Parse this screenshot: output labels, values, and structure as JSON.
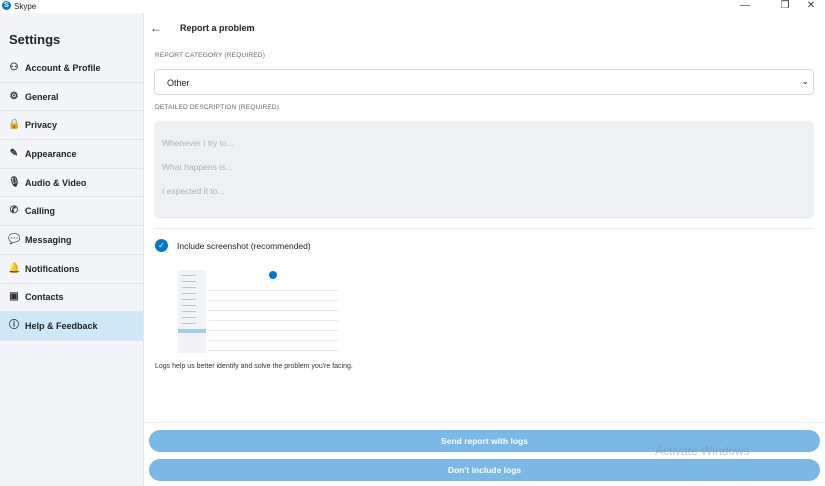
{
  "window": {
    "app_name": "Skype",
    "minimize": "—",
    "restore": "❐",
    "close": "✕"
  },
  "sidebar": {
    "title": "Settings",
    "items": [
      {
        "label": "Account & Profile",
        "icon": "person-icon",
        "glyph": "⚇"
      },
      {
        "label": "General",
        "icon": "gear-icon",
        "glyph": "⚙"
      },
      {
        "label": "Privacy",
        "icon": "lock-icon",
        "glyph": "🔒"
      },
      {
        "label": "Appearance",
        "icon": "wand-icon",
        "glyph": "✎"
      },
      {
        "label": "Audio & Video",
        "icon": "microphone-icon",
        "glyph": "🎙"
      },
      {
        "label": "Calling",
        "icon": "phone-icon",
        "glyph": "✆"
      },
      {
        "label": "Messaging",
        "icon": "chat-icon",
        "glyph": "💬"
      },
      {
        "label": "Notifications",
        "icon": "bell-icon",
        "glyph": "🔔"
      },
      {
        "label": "Contacts",
        "icon": "contacts-icon",
        "glyph": "▣"
      },
      {
        "label": "Help & Feedback",
        "icon": "info-icon",
        "glyph": "ⓘ",
        "active": true
      }
    ]
  },
  "main": {
    "back": "←",
    "title": "Report a problem",
    "category_label": "REPORT CATEGORY (REQUIRED)",
    "category_value": "Other",
    "description_label": "DETAILED DESCRIPTION (REQUIRED)",
    "description_placeholders": [
      "Whenever I try to...",
      "What happens is...",
      "I expected it to..."
    ],
    "include_screenshot": "Include screenshot (recommended)",
    "include_screenshot_checked": true,
    "logs_info": "Logs help us better identify and solve the problem you're facing.",
    "send_button": "Send report with logs",
    "no_logs_button": "Don't include logs"
  },
  "watermark": "Activate Windows"
}
